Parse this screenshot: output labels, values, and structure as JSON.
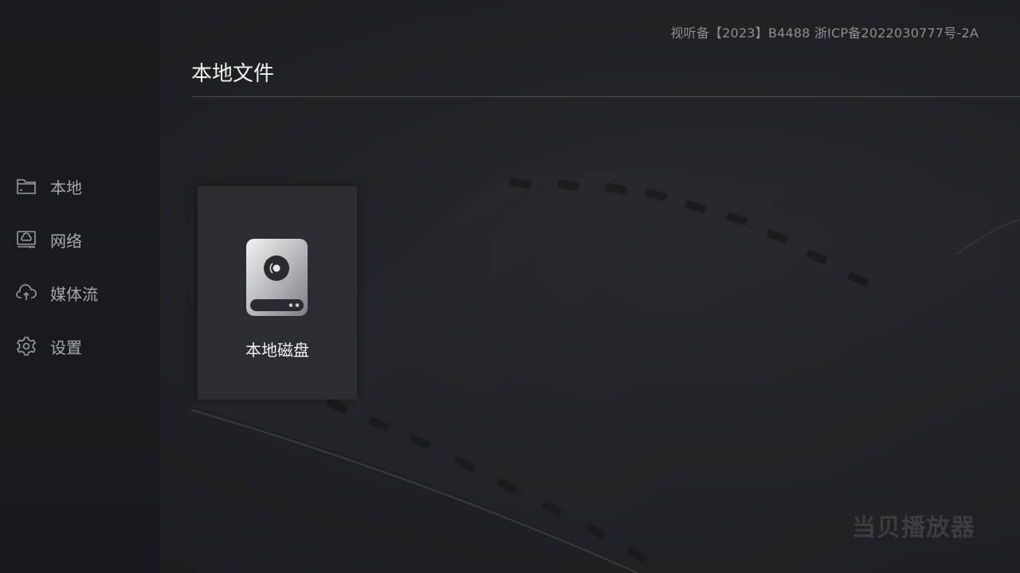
{
  "sidebar": {
    "items": [
      {
        "label": "本地",
        "icon": "folder-icon"
      },
      {
        "label": "网络",
        "icon": "network-drive-icon"
      },
      {
        "label": "媒体流",
        "icon": "cloud-upload-icon"
      },
      {
        "label": "设置",
        "icon": "gear-icon"
      }
    ]
  },
  "header": {
    "license_text": "视听备【2023】B4488   浙ICP备2022030777号-2A",
    "title": "本地文件"
  },
  "main": {
    "tiles": [
      {
        "label": "本地磁盘",
        "icon": "hard-disk-icon"
      }
    ]
  },
  "branding": {
    "watermark": "当贝播放器"
  },
  "colors": {
    "background": "#1c1d20",
    "sidebar": "#18191c",
    "card": "#2c2d31",
    "text_primary": "#f1f1f2",
    "text_secondary": "#a6a7aa"
  }
}
